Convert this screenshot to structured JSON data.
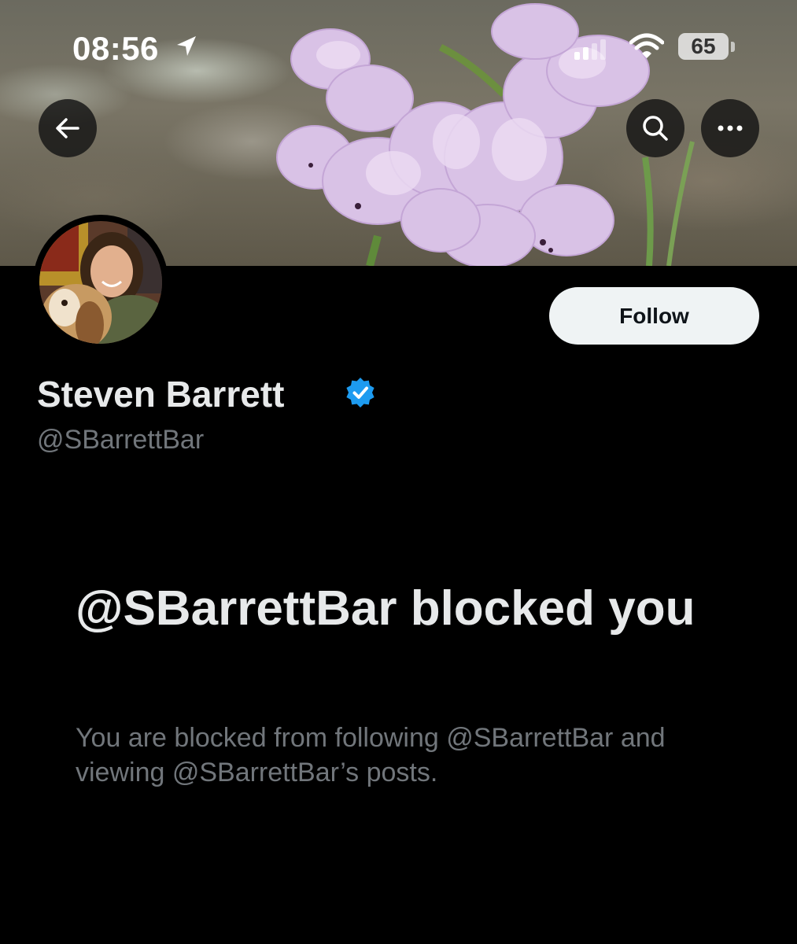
{
  "status_bar": {
    "time": "08:56",
    "battery": "65",
    "location_icon": "location-arrow-icon",
    "signal_icon": "cellular-signal-icon",
    "wifi_icon": "wifi-icon"
  },
  "nav": {
    "back_icon": "back-arrow-icon",
    "search_icon": "search-icon",
    "more_icon": "more-icon"
  },
  "profile": {
    "display_name": "Steven Barrett",
    "handle": "@SBarrettBar",
    "verified": true,
    "verified_color": "#1d9bf0",
    "follow_label": "Follow"
  },
  "blocked": {
    "title": "@SBarrettBar blocked you",
    "description": "You are blocked from following @SBarrettBar and viewing @SBarrettBar’s posts."
  },
  "colors": {
    "background": "#000000",
    "primary_text": "#e7e9ea",
    "secondary_text": "#71767b",
    "follow_bg": "#eff3f4"
  }
}
